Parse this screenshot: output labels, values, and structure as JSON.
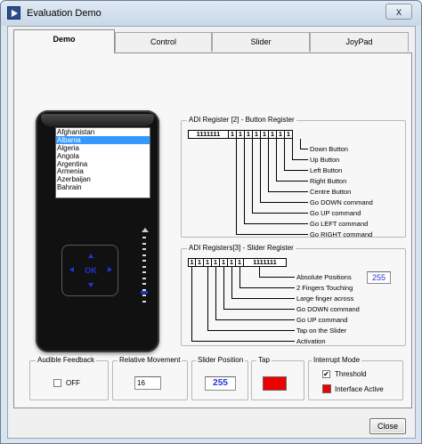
{
  "window": {
    "title": "Evaluation Demo",
    "close_glyph": "x"
  },
  "tabs": [
    {
      "label": "Demo",
      "active": true
    },
    {
      "label": "Control",
      "active": false
    },
    {
      "label": "Slider",
      "active": false
    },
    {
      "label": "JoyPad",
      "active": false
    }
  ],
  "device": {
    "list_items": [
      "Afghanistan",
      "Albania",
      "Algeria",
      "Angola",
      "Argentina",
      "Armenia",
      "Azerbaijan",
      "Bahrain"
    ],
    "selected_index": 1,
    "ok_label": "OK",
    "slider_level": 0.15,
    "accent_color": "#2234d6"
  },
  "button_register": {
    "title": "ADI Register [2] - Button Register",
    "bits": [
      "1111111",
      "1",
      "1",
      "1",
      "1",
      "1",
      "1",
      "1",
      "1"
    ],
    "labels": [
      "Down Button",
      "Up Button",
      "Left Button",
      "Right Button",
      "Centre Button",
      "Go DOWN command",
      "Go UP command",
      "Go LEFT command",
      "Go RIGHT command"
    ]
  },
  "slider_register": {
    "title": "ADI Registers[3] - Slider Register",
    "bits": [
      "1",
      "1",
      "1",
      "1",
      "1",
      "1",
      "1",
      "1111111"
    ],
    "labels": [
      "Absolute Positions",
      "2 Fingers Touching",
      "Large finger across",
      "Go DOWN command",
      "Go UP command",
      "Tap on the Slider",
      "Activation"
    ],
    "absolute_position_value": "255"
  },
  "bottom": {
    "audible_feedback": {
      "title": "Audible Feedback",
      "checkbox_label": "OFF",
      "checked": false
    },
    "relative_movement": {
      "title": "Relative Movement",
      "value": "16"
    },
    "slider_position": {
      "title": "Slider Position",
      "value": "255"
    },
    "tap": {
      "title": "Tap",
      "color": "#ee0000"
    },
    "interrupt_mode": {
      "title": "Interrupt Mode",
      "threshold_label": "Threshold",
      "threshold_checked": true,
      "interface_active_label": "Interface Active",
      "interface_active_color": "#ee0000"
    }
  },
  "close_button": {
    "label": "Close"
  }
}
